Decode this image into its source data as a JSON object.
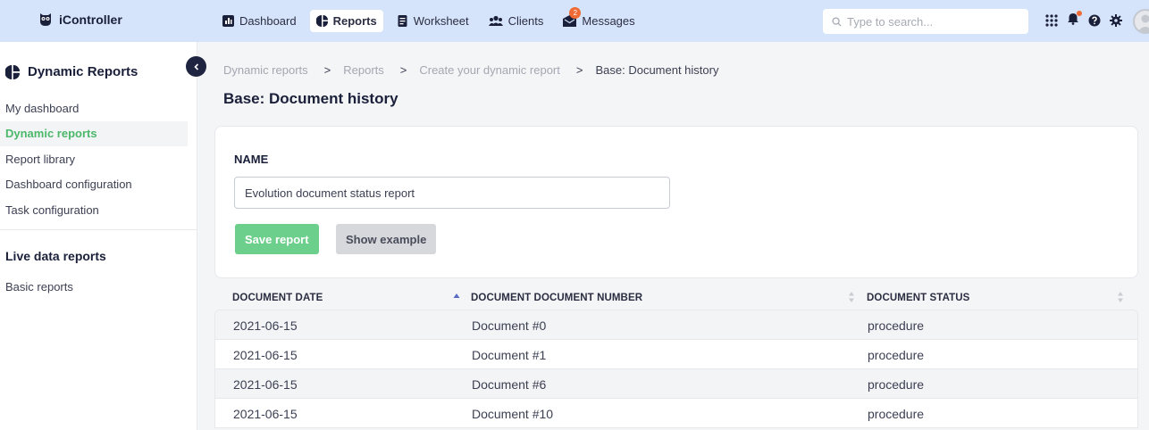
{
  "topbar": {
    "app_name": "iController",
    "nav": [
      {
        "label": "Dashboard",
        "icon": "dashboard-icon",
        "active": false
      },
      {
        "label": "Reports",
        "icon": "pie-chart-icon",
        "active": true
      },
      {
        "label": "Worksheet",
        "icon": "clipboard-icon",
        "active": false
      },
      {
        "label": "Clients",
        "icon": "users-icon",
        "active": false
      },
      {
        "label": "Messages",
        "icon": "mail-icon",
        "active": false,
        "badge": "2"
      }
    ],
    "search_placeholder": "Type to search..."
  },
  "sidebar": {
    "title": "Dynamic Reports",
    "items": [
      {
        "label": "My dashboard"
      },
      {
        "label": "Dynamic reports"
      },
      {
        "label": "Report library"
      },
      {
        "label": "Dashboard configuration"
      },
      {
        "label": "Task configuration"
      }
    ],
    "section_title": "Live data reports",
    "section_items": [
      {
        "label": "Basic reports"
      }
    ]
  },
  "breadcrumb": [
    "Dynamic reports",
    "Reports",
    "Create your dynamic report",
    "Base: Document history"
  ],
  "page_title": "Base: Document history",
  "form": {
    "name_label": "NAME",
    "name_value": "Evolution document status report",
    "save_label": "Save report",
    "example_label": "Show example"
  },
  "table": {
    "columns": [
      "DOCUMENT DATE",
      "DOCUMENT DOCUMENT NUMBER",
      "DOCUMENT STATUS"
    ],
    "sorted_column": "DOCUMENT DATE",
    "sort_direction": "ascending",
    "rows": [
      [
        "2021-06-15",
        "Document #0",
        "procedure"
      ],
      [
        "2021-06-15",
        "Document #1",
        "procedure"
      ],
      [
        "2021-06-15",
        "Document #6",
        "procedure"
      ],
      [
        "2021-06-15",
        "Document #10",
        "procedure"
      ]
    ]
  },
  "colors": {
    "topbar_bg": "#d6e4fb",
    "accent_green": "#4bb86a",
    "save_button": "#6dcf8c",
    "badge": "#ef6a34"
  }
}
